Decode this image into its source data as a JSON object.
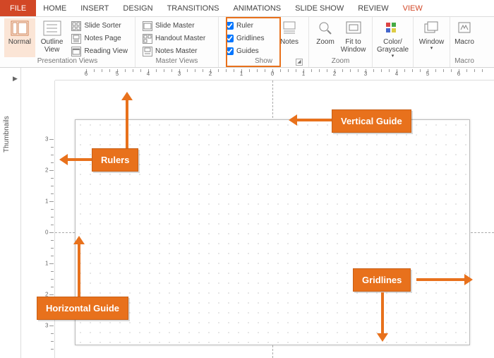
{
  "tabs": {
    "file": "FILE",
    "home": "HOME",
    "insert": "INSERT",
    "design": "DESIGN",
    "transitions": "TRANSITIONS",
    "animations": "ANIMATIONS",
    "slideshow": "SLIDE SHOW",
    "review": "REVIEW",
    "view": "VIEW"
  },
  "ribbon": {
    "presentation_views": {
      "label": "Presentation Views",
      "normal": "Normal",
      "outline": "Outline View",
      "slide_sorter": "Slide Sorter",
      "notes_page": "Notes Page",
      "reading_view": "Reading View"
    },
    "master_views": {
      "label": "Master Views",
      "slide_master": "Slide Master",
      "handout_master": "Handout Master",
      "notes_master": "Notes Master"
    },
    "show": {
      "label": "Show",
      "ruler": "Ruler",
      "gridlines": "Gridlines",
      "guides": "Guides",
      "notes": "Notes"
    },
    "zoom": {
      "label": "Zoom",
      "zoom": "Zoom",
      "fit": "Fit to Window"
    },
    "color": {
      "label": "",
      "color": "Color/ Grayscale"
    },
    "window": {
      "label": "",
      "window": "Window"
    },
    "macros": {
      "label": "Macro",
      "macros": "Macro"
    }
  },
  "thumbnails": {
    "label": "Thumbnails"
  },
  "callouts": {
    "rulers": "Rulers",
    "vguide": "Vertical Guide",
    "hguide": "Horizontal Guide",
    "gridlines": "Gridlines"
  },
  "colors": {
    "accent": "#D24726",
    "callout": "#E8711C"
  }
}
